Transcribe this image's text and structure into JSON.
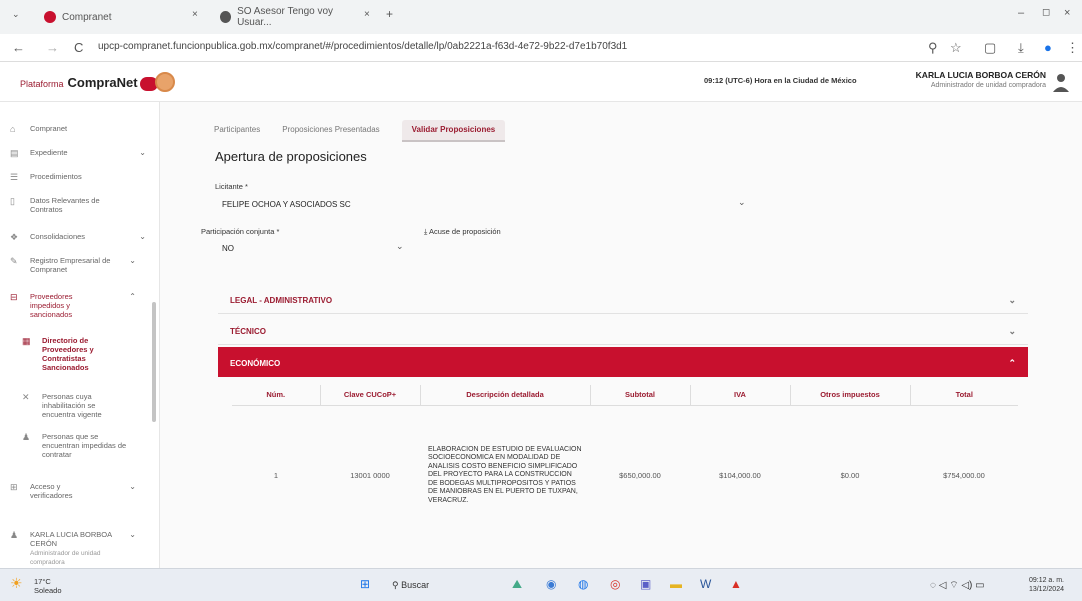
{
  "browser": {
    "tab1": "Compranet",
    "tab2": "SO Asesor Tengo voy Usuar...",
    "url": "upcp-compranet.funcionpublica.gob.mx/compranet/#/procedimientos/detalle/lp/0ab2221a-f63d-4e72-9b22-d7e1b70f3d1",
    "close": "×",
    "plus": "+",
    "back": "←",
    "fwd": "→",
    "reload": "C"
  },
  "header": {
    "logo_pre": "Plataforma",
    "logo": "CompraNet",
    "time": "09:12 (UTC-6) Hora en la Ciudad de México",
    "user_name": "KARLA LUCIA BORBOA CERÓN",
    "user_role": "Administrador de unidad compradora"
  },
  "sidebar": {
    "items": [
      {
        "label": "Compranet"
      },
      {
        "label": "Expediente"
      },
      {
        "label": "Procedimientos"
      },
      {
        "label": "Datos Relevantes de Contratos"
      },
      {
        "label": "Consolidaciones"
      },
      {
        "label": "Registro Empresarial de Compranet"
      },
      {
        "label": "Proveedores impedidos y sancionados"
      },
      {
        "label": "Directorio de Proveedores y Contratistas Sancionados"
      },
      {
        "label": "Personas cuya inhabilitación se encuentra vigente"
      },
      {
        "label": "Personas que se encuentran impedidas de contratar"
      },
      {
        "label": "Acceso y verificadores"
      },
      {
        "label": "KARLA LUCIA BORBOA CERÓN"
      },
      {
        "label": "Administrador de unidad compradora"
      }
    ]
  },
  "tabs": [
    "Participantes",
    "Proposiciones Presentadas",
    "Validar Proposiciones"
  ],
  "page": {
    "title": "Apertura de proposiciones",
    "licitante_label": "Licitante *",
    "licitante_value": "FELIPE OCHOA Y ASOCIADOS SC",
    "conjunta_label": "Participación conjunta *",
    "conjunta_value": "NO",
    "acuse": "Acuse de proposición"
  },
  "sections": {
    "legal": "LEGAL - ADMINISTRATIVO",
    "tecnico": "TÉCNICO",
    "economico": "ECONÓMICO"
  },
  "table": {
    "headers": [
      "Núm.",
      "Clave CUCoP+",
      "Descripción detallada",
      "Subtotal",
      "IVA",
      "Otros impuestos",
      "Total"
    ],
    "row": {
      "num": "1",
      "clave": "13001 0000",
      "desc": "ELABORACION DE ESTUDIO DE EVALUACION SOCIOECONOMICA EN MODALIDAD DE ANALISIS COSTO BENEFICIO SIMPLIFICADO DEL PROYECTO PARA LA CONSTRUCCION DE BODEGAS MULTIPROPOSITOS Y PATIOS DE MANIOBRAS EN EL PUERTO DE TUXPAN, VERACRUZ.",
      "subtotal": "$650,000.00",
      "iva": "$104,000.00",
      "otros": "$0.00",
      "total": "$754,000.00"
    }
  },
  "taskbar": {
    "temp": "17°C",
    "weather": "Soleado",
    "search": "Buscar",
    "time": "09:12 a. m.",
    "date": "13/12/2024"
  },
  "colors": {
    "brand": "#9b1c31",
    "accent": "#c8102e"
  }
}
